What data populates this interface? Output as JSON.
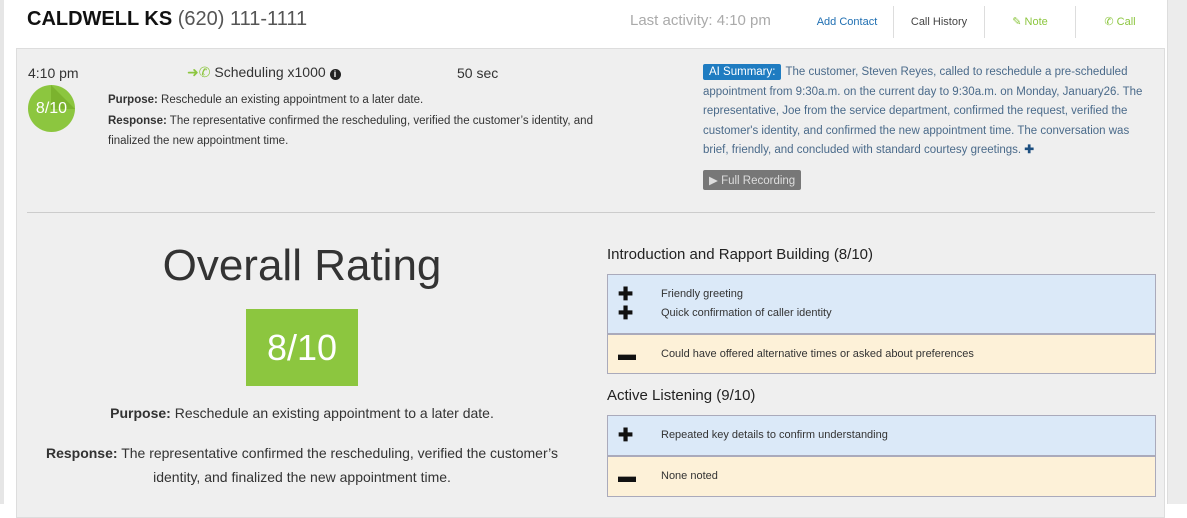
{
  "header": {
    "name": "CALDWELL KS",
    "phone": "(620) 111-1111",
    "last_activity": "Last activity: 4:10 pm",
    "nav": {
      "add_contact": "Add Contact",
      "call_history": "Call History",
      "note": "Note",
      "call": "Call"
    }
  },
  "call": {
    "time": "4:10 pm",
    "score": "8/10",
    "type": "Scheduling x1000",
    "duration": "50 sec",
    "purpose_label": "Purpose:",
    "purpose": "Reschedule an existing appointment to a later date.",
    "response_label": "Response:",
    "response": "The representative confirmed the rescheduling, verified the customer’s identity, and finalized the new appointment time.",
    "ai_label": "AI Summary:",
    "ai_summary": "The customer, Steven Reyes, called to reschedule a pre-scheduled appointment from 9:30a.m. on the current day to 9:30a.m. on Monday, January26. The representative, Joe from the service department, confirmed the request, verified the customer's identity, and confirmed the new appointment time. The conversation was brief, friendly, and concluded with standard courtesy greetings.",
    "recording": "Full Recording"
  },
  "rating": {
    "title": "Overall Rating",
    "score": "8/10"
  },
  "sections": [
    {
      "title": "Introduction and Rapport Building (8/10)",
      "positives": [
        "Friendly greeting",
        "Quick confirmation of caller identity"
      ],
      "negatives": [
        "Could have offered alternative times or asked about preferences"
      ]
    },
    {
      "title": "Active Listening (9/10)",
      "positives": [
        "Repeated key details to confirm understanding"
      ],
      "negatives": [
        "None noted"
      ]
    }
  ],
  "colors": {
    "green": "#8cc63f",
    "blue": "#1f7cc1"
  }
}
